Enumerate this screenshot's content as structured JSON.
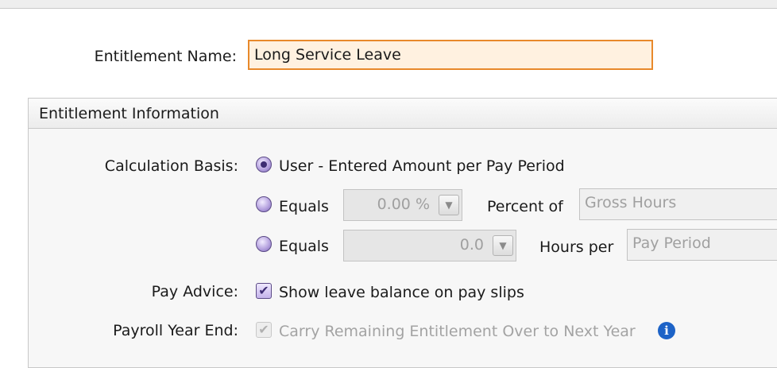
{
  "entitlement": {
    "name_label": "Entitlement Name:",
    "name_value": "Long Service Leave"
  },
  "panel": {
    "title": "Entitlement Information"
  },
  "calculation": {
    "label": "Calculation Basis:",
    "option_user": "User - Entered Amount per Pay Period",
    "option_percent": "Equals",
    "percent_value": "0.00 %",
    "percent_of_label": "Percent of",
    "percent_of_value": "Gross Hours",
    "option_hours": "Equals",
    "hours_value": "0.0",
    "hours_per_label": "Hours per",
    "hours_per_value": "Pay Period",
    "selected": "user"
  },
  "pay_advice": {
    "label": "Pay Advice:",
    "checkbox_label": "Show leave balance on pay slips",
    "checked": true
  },
  "year_end": {
    "label": "Payroll Year End:",
    "checkbox_label": "Carry Remaining Entitlement Over to Next Year",
    "checked": true,
    "enabled": false
  },
  "icons": {
    "dropdown": "chevron-down-icon",
    "info": "info-icon",
    "check": "checkmark-icon"
  },
  "colors": {
    "input_border": "#e8892b",
    "input_bg": "#fff1e0",
    "accent": "#5b4a86",
    "info": "#1d63c7"
  }
}
